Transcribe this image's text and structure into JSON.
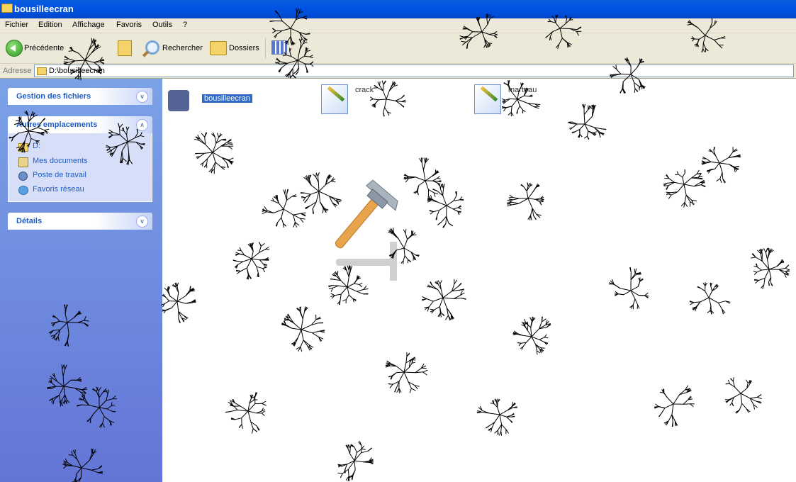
{
  "window": {
    "title": "bousilleecran"
  },
  "menu": [
    "Fichier",
    "Edition",
    "Affichage",
    "Favoris",
    "Outils",
    "?"
  ],
  "toolbar": {
    "back_label": "Précédente",
    "search_label": "Rechercher",
    "folders_label": "Dossiers"
  },
  "address": {
    "label": "Adresse",
    "path": "D:\\bousilleecran"
  },
  "left_panel": {
    "tasks": {
      "title": "Gestion des fichiers"
    },
    "other_places": {
      "title": "Autres emplacements",
      "items": [
        {
          "label": "D:",
          "icon": "drive-icon"
        },
        {
          "label": "Mes documents",
          "icon": "documents-icon"
        },
        {
          "label": "Poste de travail",
          "icon": "computer-icon"
        },
        {
          "label": "Favoris réseau",
          "icon": "network-icon"
        }
      ]
    },
    "details": {
      "title": "Détails"
    }
  },
  "files": [
    {
      "name": "bousilleecran",
      "icon": "app-icon",
      "selected": true
    },
    {
      "name": "crack",
      "icon": "bitmap-icon"
    },
    {
      "name": "marteau",
      "icon": "bitmap-icon"
    }
  ],
  "overlay": {
    "cursor": "hammer-icon",
    "effect": "cracked-screen"
  }
}
